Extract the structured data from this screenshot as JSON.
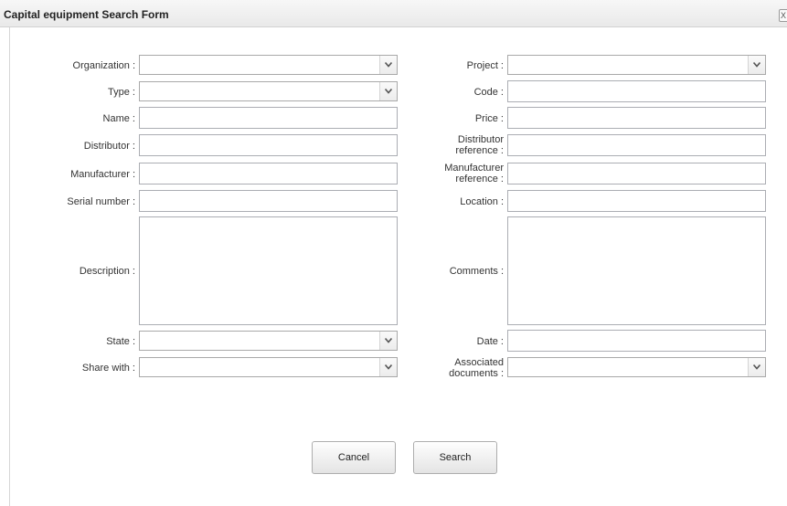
{
  "window": {
    "title": "Capital equipment Search Form",
    "close_label": "X"
  },
  "fields": {
    "organization": {
      "label": "Organization :",
      "value": ""
    },
    "type": {
      "label": "Type :",
      "value": ""
    },
    "name": {
      "label": "Name :",
      "value": ""
    },
    "distributor": {
      "label": "Distributor :",
      "value": ""
    },
    "manufacturer": {
      "label": "Manufacturer :",
      "value": ""
    },
    "serial_number": {
      "label": "Serial number :",
      "value": ""
    },
    "description": {
      "label": "Description :",
      "value": ""
    },
    "state": {
      "label": "State :",
      "value": ""
    },
    "share_with": {
      "label": "Share with :",
      "value": ""
    },
    "project": {
      "label": "Project :",
      "value": ""
    },
    "code": {
      "label": "Code :",
      "value": ""
    },
    "price": {
      "label": "Price :",
      "value": ""
    },
    "distributor_reference": {
      "label": "Distributor\nreference  :",
      "value": ""
    },
    "manufacturer_reference": {
      "label": "Manufacturer\nreference :",
      "value": ""
    },
    "location": {
      "label": "Location :",
      "value": ""
    },
    "comments": {
      "label": "Comments :",
      "value": ""
    },
    "date": {
      "label": "Date :",
      "value": ""
    },
    "associated_documents": {
      "label": "Associated\ndocuments :",
      "value": ""
    }
  },
  "buttons": {
    "cancel": "Cancel",
    "search": "Search"
  },
  "icons": {
    "dropdown": "chevron-down-icon",
    "close": "close-icon"
  }
}
